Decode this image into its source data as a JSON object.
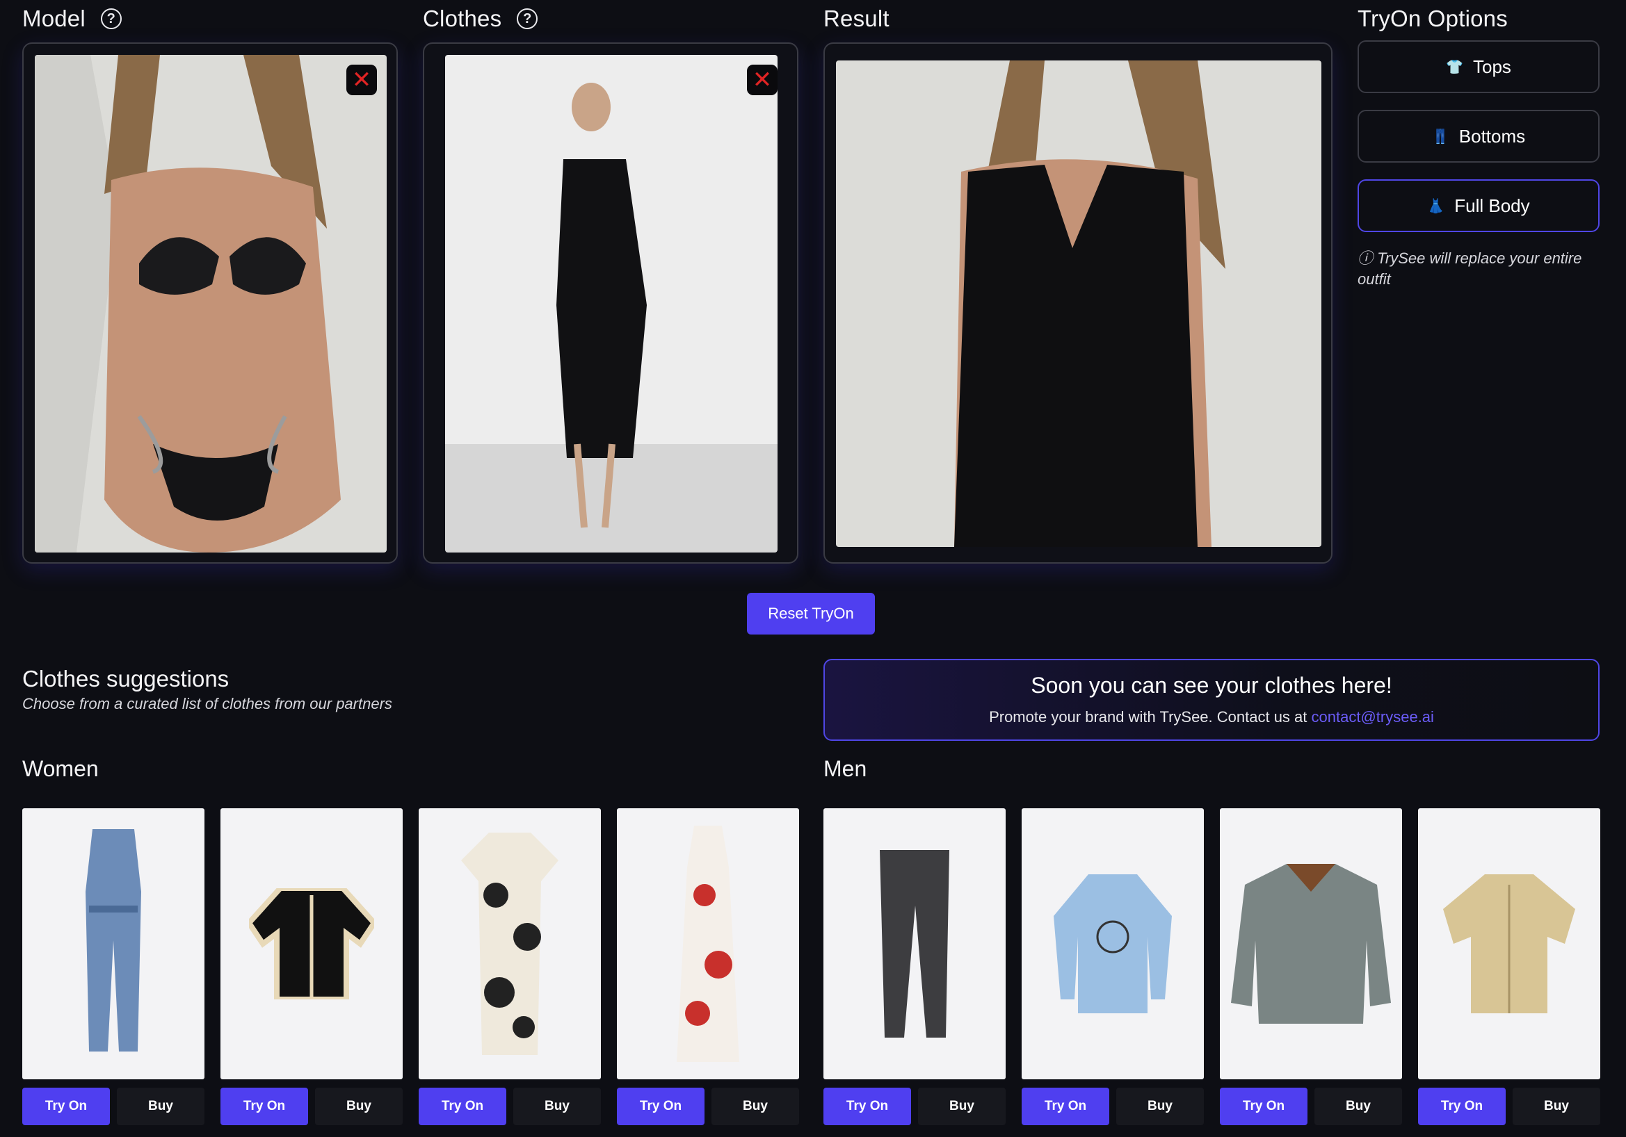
{
  "sections": {
    "model": "Model",
    "clothes": "Clothes",
    "result": "Result",
    "options": "TryOn Options"
  },
  "options": {
    "tops": "Tops",
    "bottoms": "Bottoms",
    "full_body": "Full Body",
    "active": "full_body",
    "note": "ⓘ TrySee will replace your entire outfit"
  },
  "reset_label": "Reset TryOn",
  "suggestions": {
    "title": "Clothes suggestions",
    "subtitle": "Choose from a curated list of clothes from our partners"
  },
  "promo": {
    "title": "Soon you can see your clothes here!",
    "text": "Promote your brand with TrySee. Contact us at ",
    "email": "contact@trysee.ai"
  },
  "women": {
    "title": "Women",
    "items": [
      {
        "name": "denim-jumpsuit",
        "try": "Try On",
        "buy": "Buy"
      },
      {
        "name": "black-knit-cardigan",
        "try": "Try On",
        "buy": "Buy"
      },
      {
        "name": "floral-print-dress",
        "try": "Try On",
        "buy": "Buy"
      },
      {
        "name": "red-floral-slip-dress",
        "try": "Try On",
        "buy": "Buy"
      }
    ]
  },
  "men": {
    "title": "Men",
    "items": [
      {
        "name": "grey-jeans",
        "try": "Try On",
        "buy": "Buy"
      },
      {
        "name": "blue-snoopy-sweatshirt",
        "try": "Try On",
        "buy": "Buy"
      },
      {
        "name": "grey-jacket",
        "try": "Try On",
        "buy": "Buy"
      },
      {
        "name": "beige-shirt",
        "try": "Try On",
        "buy": "Buy"
      }
    ]
  },
  "colors": {
    "accent": "#4f3ff0",
    "background": "#0d0e14",
    "close": "#e02424"
  }
}
